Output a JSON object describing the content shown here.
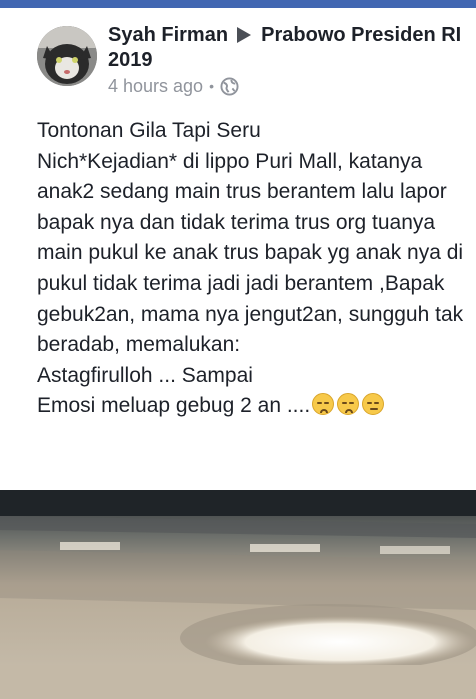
{
  "post": {
    "author": "Syah Firman",
    "target": "Prabowo Presiden RI 2019",
    "timestamp": "4 hours ago",
    "separator": "•",
    "privacy_icon": "globe-icon",
    "text": "Tontonan Gila Tapi Seru\nNich*Kejadian* di lippo Puri Mall, katanya anak2 sedang main trus berantem lalu lapor bapak nya dan tidak terima trus org tuanya main pukul ke anak  trus bapak yg anak nya di pukul tidak terima jadi jadi berantem ,Bapak gebuk2an, mama nya jengut2an, sungguh tak beradab, memalukan:\nAstagfirulloh ... Sampai\nEmosi meluap gebug 2 an ....",
    "emojis": [
      "pensive-face-icon",
      "weary-face-icon",
      "worried-face-icon"
    ]
  },
  "colors": {
    "brand_bar": "#4267b2",
    "text": "#1d2129",
    "meta": "#90949c"
  }
}
